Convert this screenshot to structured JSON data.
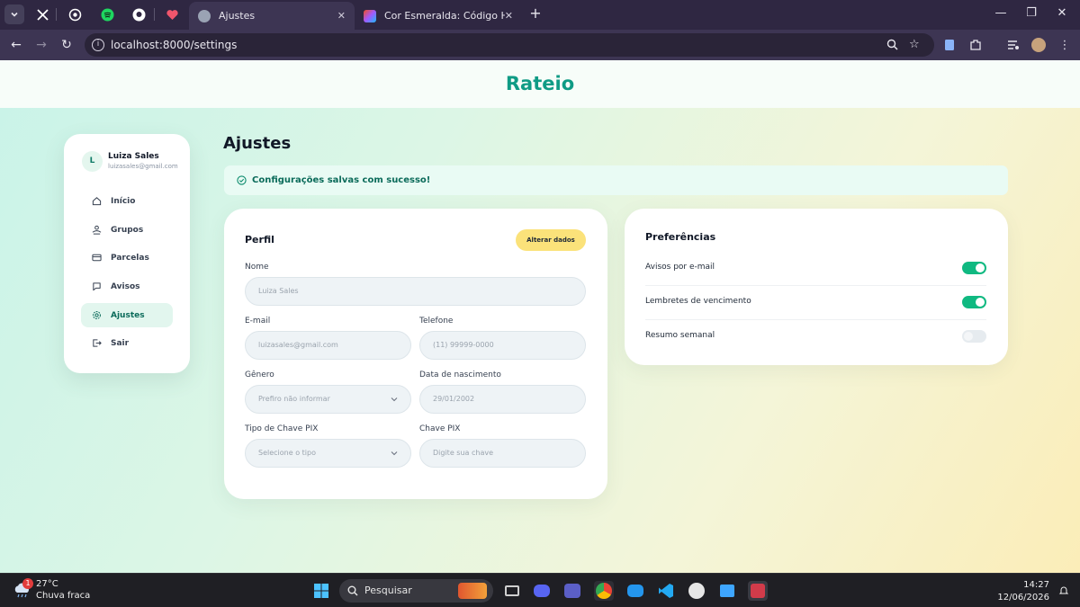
{
  "browser": {
    "tabs": [
      {
        "title": "Ajustes",
        "active": true
      },
      {
        "title": "Cor Esmeralda: Código Hex, Pal",
        "active": false
      }
    ],
    "url": "localhost:8000/settings"
  },
  "app": {
    "brand": "Rateio",
    "user": {
      "initial": "L",
      "name": "Luiza Sales",
      "email": "luizasales@gmail.com"
    },
    "nav": [
      {
        "label": "Início",
        "icon": "home-icon"
      },
      {
        "label": "Grupos",
        "icon": "groups-icon"
      },
      {
        "label": "Parcelas",
        "icon": "card-icon"
      },
      {
        "label": "Avisos",
        "icon": "chat-icon"
      },
      {
        "label": "Ajustes",
        "icon": "gear-icon",
        "active": true
      },
      {
        "label": "Sair",
        "icon": "logout-icon"
      }
    ],
    "page_title": "Ajustes",
    "success_message": "Configurações salvas com sucesso!"
  },
  "profile": {
    "title": "Perfil",
    "edit_button": "Alterar dados",
    "fields": {
      "nome": {
        "label": "Nome",
        "value": "Luiza Sales"
      },
      "email": {
        "label": "E-mail",
        "value": "luizasales@gmail.com"
      },
      "telefone": {
        "label": "Telefone",
        "placeholder": "(11) 99999-0000"
      },
      "genero": {
        "label": "Gênero",
        "value": "Prefiro não informar"
      },
      "nascimento": {
        "label": "Data de nascimento",
        "value": "29/01/2002"
      },
      "tipo_pix": {
        "label": "Tipo de Chave PIX",
        "value": "Selecione o tipo"
      },
      "chave_pix": {
        "label": "Chave PIX",
        "placeholder": "Digite sua chave"
      }
    }
  },
  "preferences": {
    "title": "Preferências",
    "items": [
      {
        "label": "Avisos por e-mail",
        "on": true
      },
      {
        "label": "Lembretes de vencimento",
        "on": true
      },
      {
        "label": "Resumo semanal",
        "on": false
      }
    ]
  },
  "taskbar": {
    "weather": {
      "badge": "1",
      "temp": "27°C",
      "desc": "Chuva fraca"
    },
    "search_label": "Pesquisar",
    "time": "14:27",
    "date": "12/06/2026"
  },
  "colors": {
    "brand": "#0f9b85",
    "toggle_on": "#10b981",
    "edit_button": "#fbe27a",
    "active_nav": "#e2f6ee"
  }
}
